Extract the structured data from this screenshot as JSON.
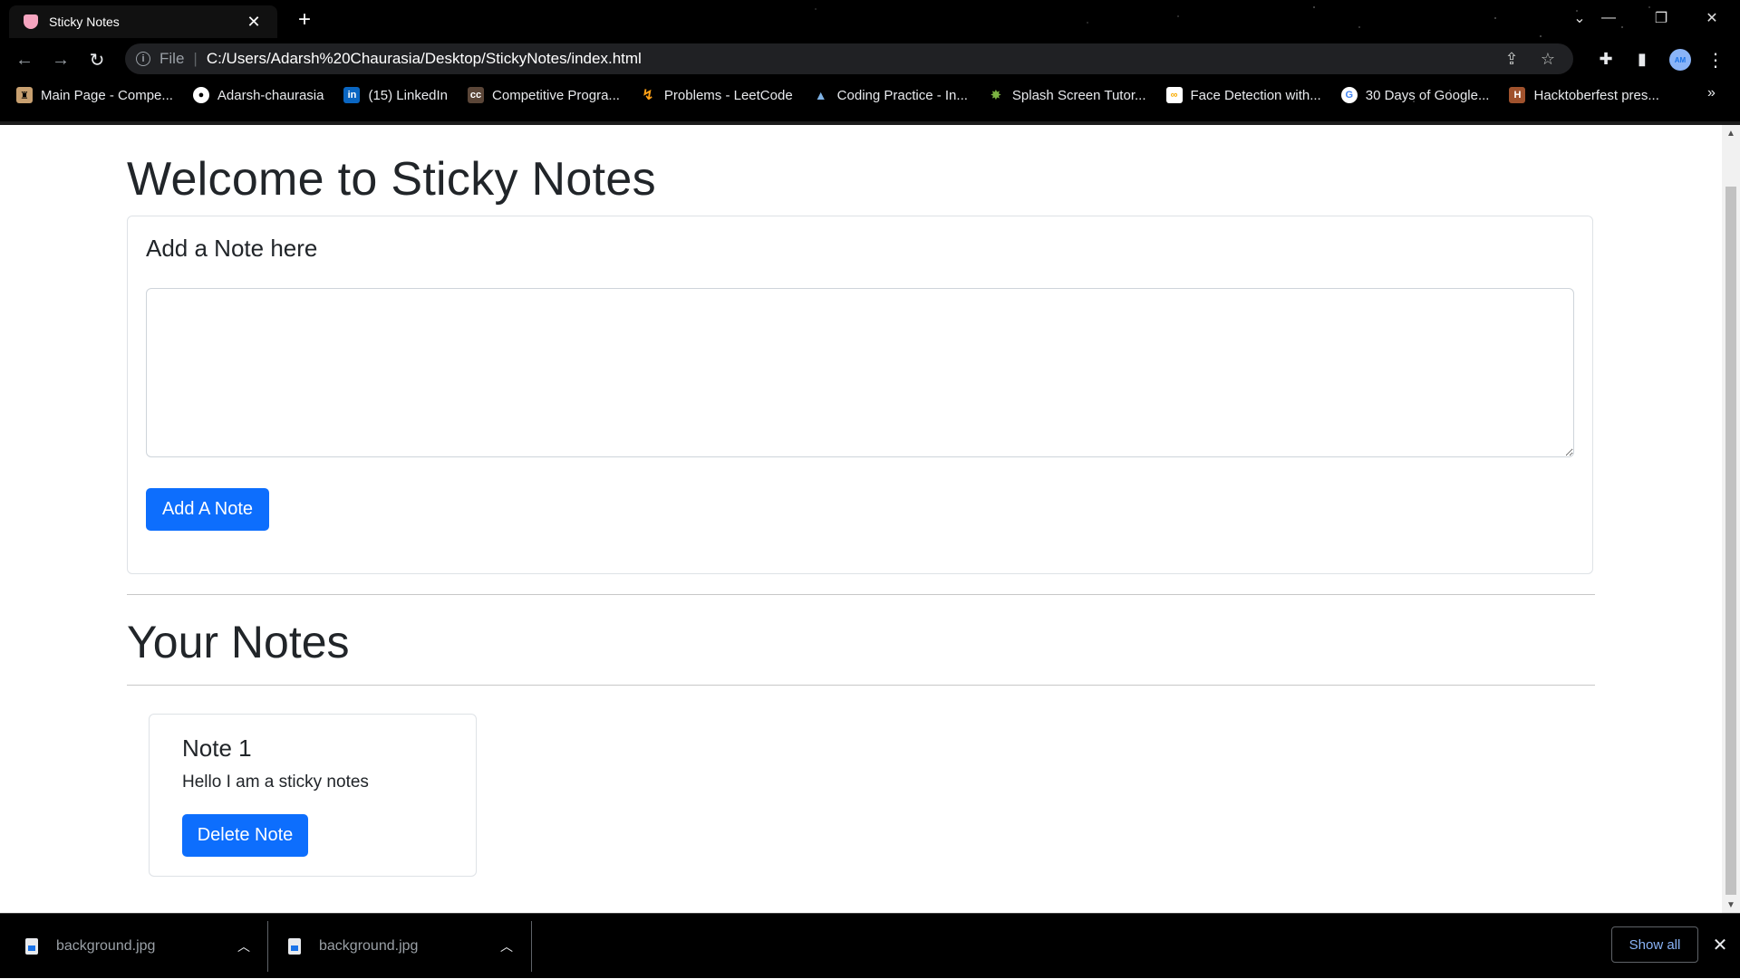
{
  "browser": {
    "tab_title": "Sticky Notes",
    "new_tab_symbol": "+",
    "scheme_label": "File",
    "url": "C:/Users/Adarsh%20Chaurasia/Desktop/StickyNotes/index.html",
    "bookmarks": [
      {
        "label": "Main Page - Compe...",
        "icon": "bookmark-icon",
        "color": "#c8a070"
      },
      {
        "label": "Adarsh-chaurasia",
        "icon": "github-icon",
        "color": "#ffffff"
      },
      {
        "label": "(15) LinkedIn",
        "icon": "linkedin-icon",
        "color": "#0a66c2"
      },
      {
        "label": "Competitive Progra...",
        "icon": "codechef-icon",
        "color": "#ffffff"
      },
      {
        "label": "Problems - LeetCode",
        "icon": "leetcode-icon",
        "color": "#ffa116"
      },
      {
        "label": "Coding Practice - In...",
        "icon": "mountain-icon",
        "color": "#7fb2e5"
      },
      {
        "label": "Splash Screen Tutor...",
        "icon": "android-icon",
        "color": "#7cb342"
      },
      {
        "label": "Face Detection with...",
        "icon": "colab-icon",
        "color": "#f9ab00"
      },
      {
        "label": "30 Days of Google...",
        "icon": "google-icon",
        "color": "#4285f4"
      },
      {
        "label": "Hacktoberfest pres...",
        "icon": "hacktoberfest-icon",
        "color": "#a0522d"
      }
    ]
  },
  "page": {
    "welcome_title": "Welcome to Sticky Notes",
    "add_card_title": "Add a Note here",
    "textarea_value": "",
    "add_button_label": "Add A Note",
    "your_notes_title": "Your Notes",
    "notes": [
      {
        "title": "Note 1",
        "text": "Hello I am a sticky notes",
        "delete_label": "Delete Note"
      }
    ]
  },
  "downloads": {
    "items": [
      {
        "name": "background.jpg"
      },
      {
        "name": "background.jpg"
      }
    ],
    "show_all_label": "Show all"
  },
  "colors": {
    "primary": "#0d6efd",
    "text": "#212529",
    "border": "#dee2e6"
  }
}
